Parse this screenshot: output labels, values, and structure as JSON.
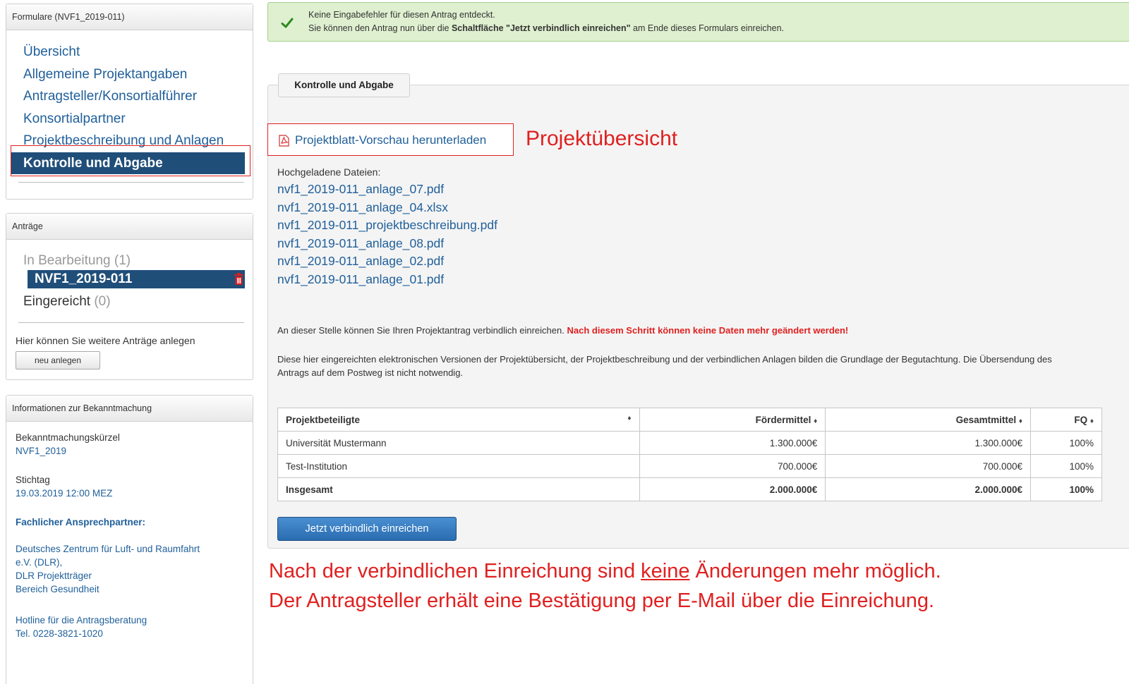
{
  "sidebar": {
    "forms_panel": {
      "title": "Formulare (NVF1_2019-011)",
      "items": [
        {
          "label": "Übersicht"
        },
        {
          "label": "Allgemeine Projektangaben"
        },
        {
          "label": "Antragsteller/Konsortialführer"
        },
        {
          "label": "Konsortialpartner"
        },
        {
          "label": "Projektbeschreibung und Anlagen"
        },
        {
          "label": "Kontrolle und Abgabe",
          "active": true
        }
      ]
    },
    "applications_panel": {
      "title": "Anträge",
      "in_progress_label": "In Bearbeitung",
      "in_progress_count": "(1)",
      "selected": "NVF1_2019-011",
      "submitted_label": "Eingereicht",
      "submitted_count": "(0)",
      "hint": "Hier können Sie weitere Anträge anlegen",
      "new_button": "neu anlegen"
    },
    "info_panel": {
      "title": "Informationen zur Bekanntmachung",
      "abbr_label": "Bekanntmachungskürzel",
      "abbr_value": "NVF1_2019",
      "deadline_label": "Stichtag",
      "deadline_value": "19.03.2019 12:00 MEZ",
      "contact_heading": "Fachlicher Ansprechpartner:",
      "contact_lines": [
        "Deutsches Zentrum für Luft- und Raumfahrt",
        "e.V. (DLR),",
        "DLR Projektträger",
        "Bereich Gesundheit"
      ],
      "hotline_label": "Hotline für die Antragsberatung",
      "hotline_value": "Tel. 0228-3821-1020"
    }
  },
  "alert": {
    "line1": "Keine Eingabefehler für diesen Antrag entdeckt.",
    "line2_pre": "Sie können den Antrag nun über die ",
    "line2_bold": "Schaltfläche \"Jetzt verbindlich einreichen\"",
    "line2_post": " am Ende dieses Formulars einreichen."
  },
  "section": {
    "legend": "Kontrolle und Abgabe",
    "download_link": "Projektblatt-Vorschau herunterladen",
    "callout": "Projektübersicht",
    "files_heading": "Hochgeladene Dateien:",
    "files": [
      "nvf1_2019-011_anlage_07.pdf",
      "nvf1_2019-011_anlage_04.xlsx",
      "nvf1_2019-011_projektbeschreibung.pdf",
      "nvf1_2019-011_anlage_08.pdf",
      "nvf1_2019-011_anlage_02.pdf",
      "nvf1_2019-011_anlage_01.pdf"
    ],
    "para1": "An dieser Stelle können Sie Ihren Projektantrag verbindlich einreichen.",
    "para1_warning": "Nach diesem Schritt können keine Daten mehr geändert werden!",
    "para2": "Diese hier eingereichten elektronischen Versionen der Projektübersicht, der Projektbeschreibung und der verbindlichen Anlagen bilden die Grundlage der Begutachtung. Die Übersendung des Antrags auf dem Postweg ist nicht notwendig.",
    "table": {
      "headers": [
        "Projektbeteiligte",
        "Fördermittel",
        "Gesamtmittel",
        "FQ"
      ],
      "rows": [
        [
          "Universität Mustermann",
          "1.300.000€",
          "1.300.000€",
          "100%"
        ],
        [
          "Test-Institution",
          "700.000€",
          "700.000€",
          "100%"
        ]
      ],
      "total": [
        "Insgesamt",
        "2.000.000€",
        "2.000.000€",
        "100%"
      ]
    },
    "submit_button": "Jetzt verbindlich einreichen"
  },
  "annotations": {
    "note_line1_pre": "Nach der verbindlichen Einreichung sind ",
    "note_line1_underlined": "keine",
    "note_line1_post": " Änderungen mehr möglich.",
    "note_line2": "Der Antragsteller erhält eine Bestätigung per E-Mail über die Einreichung."
  },
  "colors": {
    "link": "#1f5f9a",
    "active_nav": "#1f4e79",
    "annotation_red": "#e02020",
    "success_bg": "#dff0d0"
  },
  "icons": [
    "check-icon",
    "pdf-icon",
    "trash-icon",
    "sort-icon"
  ]
}
